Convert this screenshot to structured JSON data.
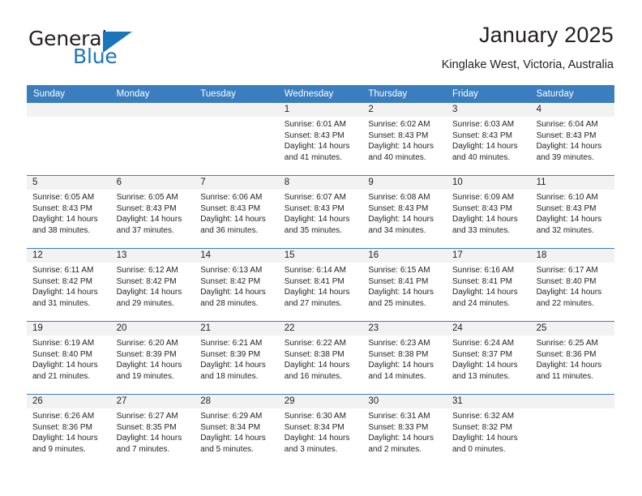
{
  "brand": {
    "word_one": "General",
    "word_two": "Blue",
    "triangle_icon": "triangle-icon"
  },
  "header": {
    "title": "January 2025",
    "subtitle": "Kinglake West, Victoria, Australia"
  },
  "colors": {
    "header_blue": "#3a7ebf",
    "brand_blue": "#1b75bb",
    "daynum_band": "#f2f2f2",
    "text": "#231f20"
  },
  "calendar": {
    "weekday_headers": [
      "Sunday",
      "Monday",
      "Tuesday",
      "Wednesday",
      "Thursday",
      "Friday",
      "Saturday"
    ],
    "weeks": [
      [
        {
          "day": "",
          "lines": []
        },
        {
          "day": "",
          "lines": []
        },
        {
          "day": "",
          "lines": []
        },
        {
          "day": "1",
          "lines": [
            "Sunrise: 6:01 AM",
            "Sunset: 8:43 PM",
            "Daylight: 14 hours",
            "and 41 minutes."
          ]
        },
        {
          "day": "2",
          "lines": [
            "Sunrise: 6:02 AM",
            "Sunset: 8:43 PM",
            "Daylight: 14 hours",
            "and 40 minutes."
          ]
        },
        {
          "day": "3",
          "lines": [
            "Sunrise: 6:03 AM",
            "Sunset: 8:43 PM",
            "Daylight: 14 hours",
            "and 40 minutes."
          ]
        },
        {
          "day": "4",
          "lines": [
            "Sunrise: 6:04 AM",
            "Sunset: 8:43 PM",
            "Daylight: 14 hours",
            "and 39 minutes."
          ]
        }
      ],
      [
        {
          "day": "5",
          "lines": [
            "Sunrise: 6:05 AM",
            "Sunset: 8:43 PM",
            "Daylight: 14 hours",
            "and 38 minutes."
          ]
        },
        {
          "day": "6",
          "lines": [
            "Sunrise: 6:05 AM",
            "Sunset: 8:43 PM",
            "Daylight: 14 hours",
            "and 37 minutes."
          ]
        },
        {
          "day": "7",
          "lines": [
            "Sunrise: 6:06 AM",
            "Sunset: 8:43 PM",
            "Daylight: 14 hours",
            "and 36 minutes."
          ]
        },
        {
          "day": "8",
          "lines": [
            "Sunrise: 6:07 AM",
            "Sunset: 8:43 PM",
            "Daylight: 14 hours",
            "and 35 minutes."
          ]
        },
        {
          "day": "9",
          "lines": [
            "Sunrise: 6:08 AM",
            "Sunset: 8:43 PM",
            "Daylight: 14 hours",
            "and 34 minutes."
          ]
        },
        {
          "day": "10",
          "lines": [
            "Sunrise: 6:09 AM",
            "Sunset: 8:43 PM",
            "Daylight: 14 hours",
            "and 33 minutes."
          ]
        },
        {
          "day": "11",
          "lines": [
            "Sunrise: 6:10 AM",
            "Sunset: 8:43 PM",
            "Daylight: 14 hours",
            "and 32 minutes."
          ]
        }
      ],
      [
        {
          "day": "12",
          "lines": [
            "Sunrise: 6:11 AM",
            "Sunset: 8:42 PM",
            "Daylight: 14 hours",
            "and 31 minutes."
          ]
        },
        {
          "day": "13",
          "lines": [
            "Sunrise: 6:12 AM",
            "Sunset: 8:42 PM",
            "Daylight: 14 hours",
            "and 29 minutes."
          ]
        },
        {
          "day": "14",
          "lines": [
            "Sunrise: 6:13 AM",
            "Sunset: 8:42 PM",
            "Daylight: 14 hours",
            "and 28 minutes."
          ]
        },
        {
          "day": "15",
          "lines": [
            "Sunrise: 6:14 AM",
            "Sunset: 8:41 PM",
            "Daylight: 14 hours",
            "and 27 minutes."
          ]
        },
        {
          "day": "16",
          "lines": [
            "Sunrise: 6:15 AM",
            "Sunset: 8:41 PM",
            "Daylight: 14 hours",
            "and 25 minutes."
          ]
        },
        {
          "day": "17",
          "lines": [
            "Sunrise: 6:16 AM",
            "Sunset: 8:41 PM",
            "Daylight: 14 hours",
            "and 24 minutes."
          ]
        },
        {
          "day": "18",
          "lines": [
            "Sunrise: 6:17 AM",
            "Sunset: 8:40 PM",
            "Daylight: 14 hours",
            "and 22 minutes."
          ]
        }
      ],
      [
        {
          "day": "19",
          "lines": [
            "Sunrise: 6:19 AM",
            "Sunset: 8:40 PM",
            "Daylight: 14 hours",
            "and 21 minutes."
          ]
        },
        {
          "day": "20",
          "lines": [
            "Sunrise: 6:20 AM",
            "Sunset: 8:39 PM",
            "Daylight: 14 hours",
            "and 19 minutes."
          ]
        },
        {
          "day": "21",
          "lines": [
            "Sunrise: 6:21 AM",
            "Sunset: 8:39 PM",
            "Daylight: 14 hours",
            "and 18 minutes."
          ]
        },
        {
          "day": "22",
          "lines": [
            "Sunrise: 6:22 AM",
            "Sunset: 8:38 PM",
            "Daylight: 14 hours",
            "and 16 minutes."
          ]
        },
        {
          "day": "23",
          "lines": [
            "Sunrise: 6:23 AM",
            "Sunset: 8:38 PM",
            "Daylight: 14 hours",
            "and 14 minutes."
          ]
        },
        {
          "day": "24",
          "lines": [
            "Sunrise: 6:24 AM",
            "Sunset: 8:37 PM",
            "Daylight: 14 hours",
            "and 13 minutes."
          ]
        },
        {
          "day": "25",
          "lines": [
            "Sunrise: 6:25 AM",
            "Sunset: 8:36 PM",
            "Daylight: 14 hours",
            "and 11 minutes."
          ]
        }
      ],
      [
        {
          "day": "26",
          "lines": [
            "Sunrise: 6:26 AM",
            "Sunset: 8:36 PM",
            "Daylight: 14 hours",
            "and 9 minutes."
          ]
        },
        {
          "day": "27",
          "lines": [
            "Sunrise: 6:27 AM",
            "Sunset: 8:35 PM",
            "Daylight: 14 hours",
            "and 7 minutes."
          ]
        },
        {
          "day": "28",
          "lines": [
            "Sunrise: 6:29 AM",
            "Sunset: 8:34 PM",
            "Daylight: 14 hours",
            "and 5 minutes."
          ]
        },
        {
          "day": "29",
          "lines": [
            "Sunrise: 6:30 AM",
            "Sunset: 8:34 PM",
            "Daylight: 14 hours",
            "and 3 minutes."
          ]
        },
        {
          "day": "30",
          "lines": [
            "Sunrise: 6:31 AM",
            "Sunset: 8:33 PM",
            "Daylight: 14 hours",
            "and 2 minutes."
          ]
        },
        {
          "day": "31",
          "lines": [
            "Sunrise: 6:32 AM",
            "Sunset: 8:32 PM",
            "Daylight: 14 hours",
            "and 0 minutes."
          ]
        },
        {
          "day": "",
          "lines": []
        }
      ]
    ]
  }
}
